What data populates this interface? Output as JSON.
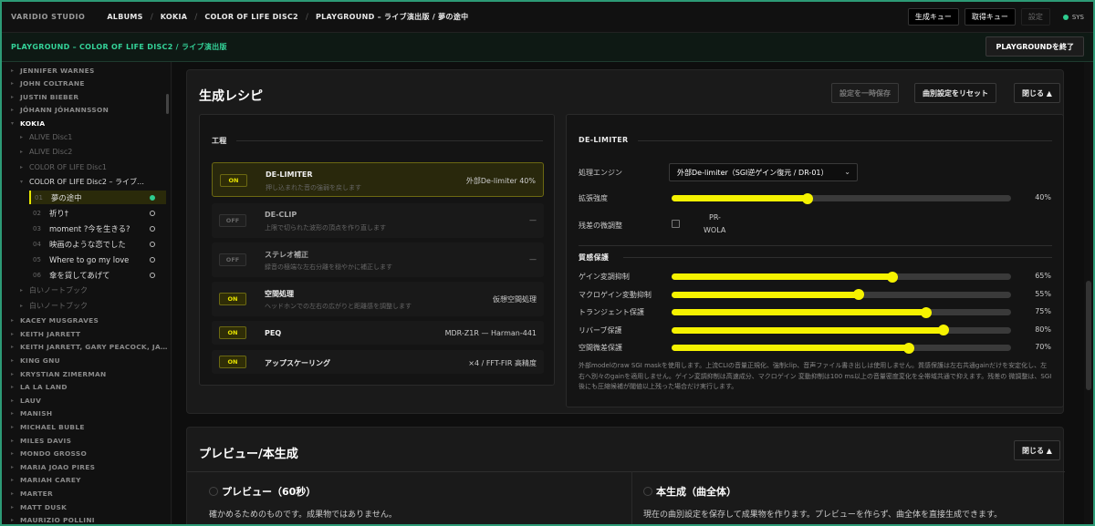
{
  "topbar": {
    "brand": "VARIDIO STUDIO",
    "crumbs": [
      "ALBUMS",
      "KOKIA",
      "COLOR OF LIFE DISC2",
      "PLAYGROUND – ライブ演出版 / 夢の途中"
    ],
    "separator": "/",
    "btn_gen_queue": "生成キュー",
    "btn_fetch_queue": "取得キュー",
    "btn_settings": "設定",
    "sys_label": "SYS"
  },
  "playground": {
    "title": "PLAYGROUND – COLOR OF LIFE DISC2 / ライブ演出版",
    "exit_button": "PLAYGROUNDを終了"
  },
  "sidebar": {
    "items": [
      {
        "kind": "artist",
        "label": "JENNIFER WARNES"
      },
      {
        "kind": "artist",
        "label": "JOHN COLTRANE"
      },
      {
        "kind": "artist",
        "label": "JUSTIN BIEBER"
      },
      {
        "kind": "artist",
        "label": "JÓHANN JÓHANNSSON"
      },
      {
        "kind": "artist",
        "label": "KOKIA",
        "active": true
      },
      {
        "kind": "album",
        "label": "ALIVE Disc1"
      },
      {
        "kind": "album",
        "label": "ALIVE Disc2"
      },
      {
        "kind": "album",
        "label": "COLOR OF LIFE Disc1"
      },
      {
        "kind": "album",
        "label": "COLOR OF LIFE Disc2 – ライブ…",
        "active": true
      },
      {
        "kind": "track",
        "num": "01",
        "label": "夢の途中",
        "active": true
      },
      {
        "kind": "track",
        "num": "02",
        "label": "祈り†"
      },
      {
        "kind": "track",
        "num": "03",
        "label": "moment ?今を生きる?"
      },
      {
        "kind": "track",
        "num": "04",
        "label": "映画のような恋でした"
      },
      {
        "kind": "track",
        "num": "05",
        "label": "Where to go my love"
      },
      {
        "kind": "track",
        "num": "06",
        "label": "傘を貸してあげて"
      },
      {
        "kind": "album",
        "label": "白いノートブック"
      },
      {
        "kind": "album",
        "label": "白いノートブック"
      },
      {
        "kind": "artist",
        "label": "KACEY MUSGRAVES"
      },
      {
        "kind": "artist",
        "label": "KEITH JARRETT"
      },
      {
        "kind": "artist",
        "label": "KEITH JARRETT, GARY PEACOCK, JA…"
      },
      {
        "kind": "artist",
        "label": "KING GNU"
      },
      {
        "kind": "artist",
        "label": "KRYSTIAN ZIMERMAN"
      },
      {
        "kind": "artist",
        "label": "LA LA LAND"
      },
      {
        "kind": "artist",
        "label": "LAUV"
      },
      {
        "kind": "artist",
        "label": "MANISH"
      },
      {
        "kind": "artist",
        "label": "MICHAEL BUBLE"
      },
      {
        "kind": "artist",
        "label": "MILES DAVIS"
      },
      {
        "kind": "artist",
        "label": "MONDO GROSSO"
      },
      {
        "kind": "artist",
        "label": "MARIA JOAO PIRES"
      },
      {
        "kind": "artist",
        "label": "MARIAH CAREY"
      },
      {
        "kind": "artist",
        "label": "MARTER"
      },
      {
        "kind": "artist",
        "label": "MATT DUSK"
      },
      {
        "kind": "artist",
        "label": "MAURIZIO POLLINI"
      }
    ]
  },
  "recipe": {
    "title": "生成レシピ",
    "btn_save_temp": "設定を一時保存",
    "btn_reset": "曲別設定をリセット",
    "btn_close": "閉じる ▲",
    "process_header": "工程",
    "processes": [
      {
        "state": "ON",
        "name": "DE-LIMITER",
        "desc": "押し込まれた音の強弱を戻します",
        "value": "外部De-limiter 40%",
        "highlight": true
      },
      {
        "state": "OFF",
        "name": "DE-CLIP",
        "desc": "上限で切られた波形の頂点を作り直します",
        "value": "—"
      },
      {
        "state": "OFF",
        "name": "ステレオ補正",
        "desc": "録音の極端な左右分離を穏やかに補正します",
        "value": "—"
      },
      {
        "state": "ON",
        "name": "空間処理",
        "desc": "ヘッドホンでの左右の広がりと距離感を調整します",
        "value": "仮想空間処理"
      },
      {
        "state": "ON",
        "name": "PEQ",
        "desc": "",
        "value": "MDR-Z1R — Harman-441"
      },
      {
        "state": "ON",
        "name": "アップスケーリング",
        "desc": "",
        "value": "×4 / FFT-FIR 高精度"
      }
    ],
    "delimiter": {
      "header": "DE-LIMITER",
      "engine_label": "処理エンジン",
      "engine_value": "外部De-limiter（SGI逆ゲイン復元 / DR-01）",
      "strength_label": "拡張強度",
      "strength_value": 40,
      "strength_text": "40%",
      "residual_label": "残差の微調整",
      "residual_option_line1": "PR-",
      "residual_option_line2": "WOLA",
      "quality_header": "質感保護",
      "sliders": [
        {
          "label": "ゲイン変調抑制",
          "value": 65,
          "text": "65%"
        },
        {
          "label": "マクロゲイン変動抑制",
          "value": 55,
          "text": "55%"
        },
        {
          "label": "トランジェント保護",
          "value": 75,
          "text": "75%"
        },
        {
          "label": "リバーブ保護",
          "value": 80,
          "text": "80%"
        },
        {
          "label": "空間微差保護",
          "value": 70,
          "text": "70%"
        }
      ],
      "note": "外部modelのraw SGI maskを使用します。上流CLIの音量正規化、強制clip、音声ファイル書き出しは使用しません。質感保護は左右共通gainだけを安定化し、左右へ別々のgainを適用しません。ゲイン変調抑制は高速成分、マクロゲイン 変動抑制は100 ms以上の音量密度変化を全帯域共通で抑えます。残差の 微調整は、SGI後にも圧縮候補が閾値以上残った場合だけ実行します。"
    }
  },
  "preview": {
    "title": "プレビュー/本生成",
    "btn_close": "閉じる ▲",
    "options": [
      {
        "title": "プレビュー（60秒）",
        "desc": "確かめるためのものです。成果物ではありません。"
      },
      {
        "title": "本生成（曲全体）",
        "desc": "現在の曲別設定を保存して成果物を作ります。プレビューを作らず、曲全体を直接生成できます。"
      }
    ]
  },
  "colors": {
    "accent": "#f5f200",
    "green": "#2ecc8f",
    "frame": "#2d9b76"
  }
}
